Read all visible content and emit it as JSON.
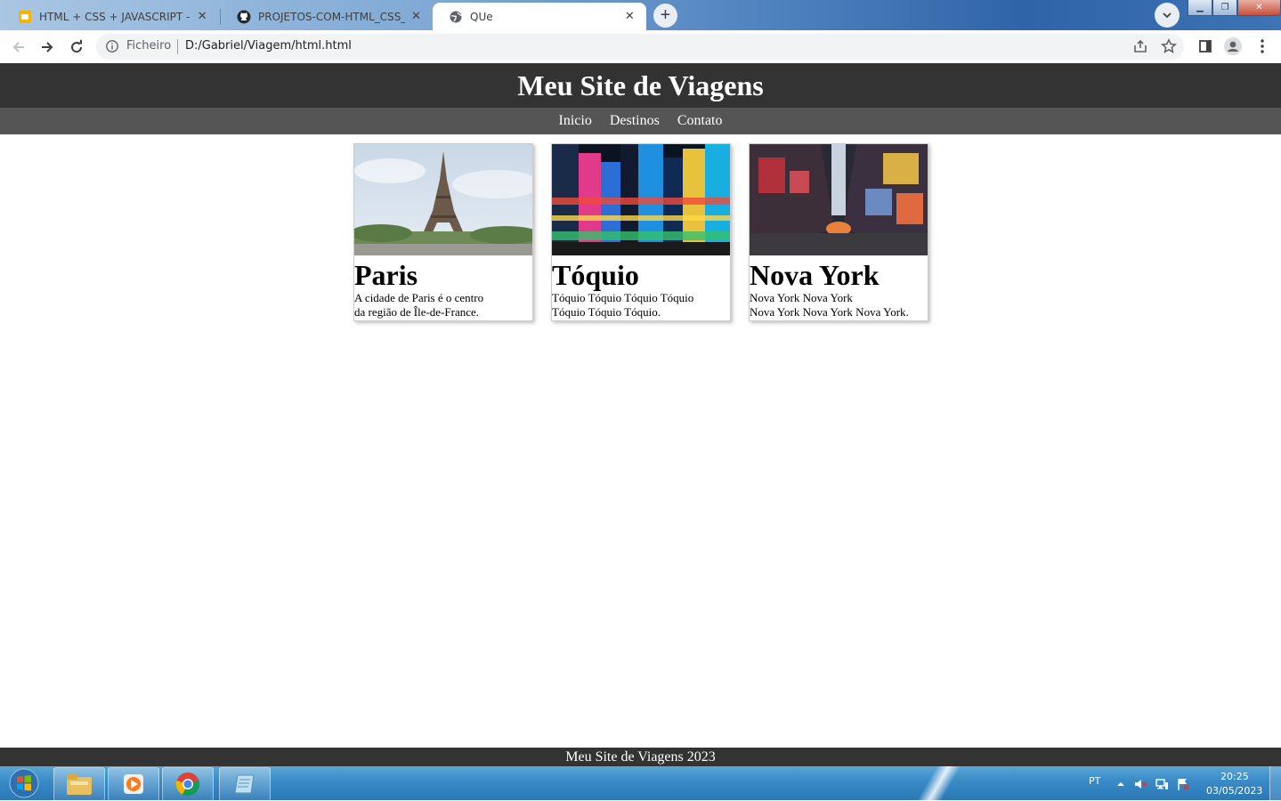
{
  "browser": {
    "tabs": [
      {
        "title": "HTML + CSS + JAVASCRIPT - Google",
        "active": false
      },
      {
        "title": "PROJETOS-COM-HTML_CSS_JAVASCRIPT",
        "active": false
      },
      {
        "title": "QUe",
        "active": true
      }
    ],
    "address": {
      "scheme": "Ficheiro",
      "url": "D:/Gabriel/Viagem/html.html"
    }
  },
  "page": {
    "title": "Meu Site de Viagens",
    "nav": [
      "Inicio",
      "Destinos",
      "Contato"
    ],
    "cards": [
      {
        "title": "Paris",
        "text_line1": "A cidade de Paris é o centro",
        "text_line2": "da região de Île-de-France."
      },
      {
        "title": "Tóquio",
        "text_line1": "Tóquio Tóquio Tóquio Tóquio",
        "text_line2": "Tóquio Tóquio Tóquio."
      },
      {
        "title": "Nova York",
        "text_line1": "Nova York Nova York",
        "text_line2": "Nova York Nova York Nova York."
      }
    ],
    "footer": "Meu Site de Viagens 2023"
  },
  "taskbar": {
    "language": "PT",
    "time": "20:25",
    "date": "03/05/2023"
  },
  "colors": {
    "header_bg": "#333333",
    "nav_bg": "#555555",
    "footer_bg": "#333333"
  }
}
